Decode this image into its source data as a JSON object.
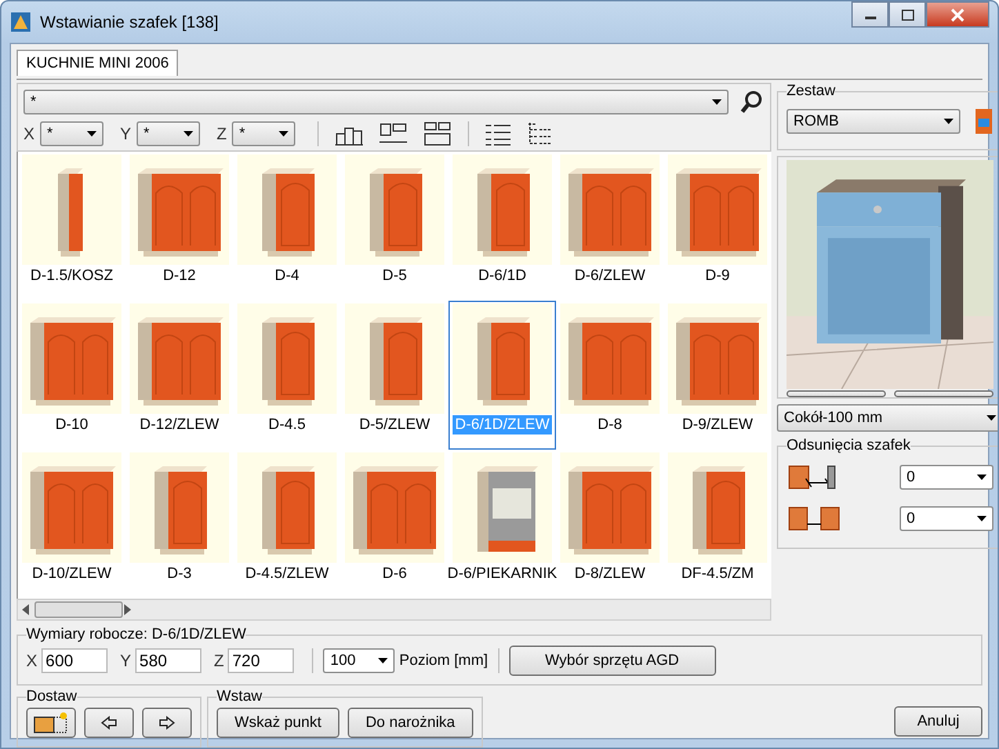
{
  "window": {
    "title": "Wstawianie szafek [138]"
  },
  "tabs": [
    {
      "label": "KUCHNIE MINI 2006",
      "selected": true
    }
  ],
  "filter": {
    "value": "*",
    "axes": [
      {
        "label": "X",
        "value": "*"
      },
      {
        "label": "Y",
        "value": "*"
      },
      {
        "label": "Z",
        "value": "*"
      }
    ]
  },
  "items": [
    {
      "label": "D-1.5/KOSZ",
      "kind": "narrow",
      "selected": false
    },
    {
      "label": "D-12",
      "kind": "double",
      "selected": false
    },
    {
      "label": "D-4",
      "kind": "single",
      "selected": false
    },
    {
      "label": "D-5",
      "kind": "single",
      "selected": false
    },
    {
      "label": "D-6/1D",
      "kind": "single",
      "selected": false
    },
    {
      "label": "D-6/ZLEW",
      "kind": "double",
      "selected": false
    },
    {
      "label": "D-9",
      "kind": "double",
      "selected": false
    },
    {
      "label": "D-10",
      "kind": "double",
      "selected": false
    },
    {
      "label": "D-12/ZLEW",
      "kind": "double",
      "selected": false
    },
    {
      "label": "D-4.5",
      "kind": "single",
      "selected": false
    },
    {
      "label": "D-5/ZLEW",
      "kind": "single",
      "selected": false
    },
    {
      "label": "D-6/1D/ZLEW",
      "kind": "single",
      "selected": true
    },
    {
      "label": "D-8",
      "kind": "double",
      "selected": false
    },
    {
      "label": "D-9/ZLEW",
      "kind": "double",
      "selected": false
    },
    {
      "label": "D-10/ZLEW",
      "kind": "double",
      "selected": false
    },
    {
      "label": "D-3",
      "kind": "single",
      "selected": false
    },
    {
      "label": "D-4.5/ZLEW",
      "kind": "single",
      "selected": false
    },
    {
      "label": "D-6",
      "kind": "double",
      "selected": false
    },
    {
      "label": "D-6/PIEKARNIK",
      "kind": "oven",
      "selected": false
    },
    {
      "label": "D-8/ZLEW",
      "kind": "double",
      "selected": false
    },
    {
      "label": "DF-4.5/ZM",
      "kind": "single",
      "selected": false
    }
  ],
  "set": {
    "title": "Zestaw",
    "value": "ROMB"
  },
  "plinth": {
    "value": "Cokół-100 mm"
  },
  "offsets": {
    "title": "Odsunięcia szafek",
    "rows": [
      {
        "value": "0"
      },
      {
        "value": "0"
      }
    ]
  },
  "dimensions": {
    "title": "Wymiary robocze: D-6/1D/ZLEW",
    "fields": [
      {
        "label": "X",
        "value": "600"
      },
      {
        "label": "Y",
        "value": "580"
      },
      {
        "label": "Z",
        "value": "720"
      }
    ],
    "level_value": "100",
    "level_label": "Poziom [mm]",
    "appliance_button": "Wybór sprzętu AGD"
  },
  "dostaw": {
    "title": "Dostaw"
  },
  "wstaw": {
    "title": "Wstaw",
    "buttons": [
      "Wskaż punkt",
      "Do narożnika"
    ]
  },
  "cancel": "Anuluj"
}
